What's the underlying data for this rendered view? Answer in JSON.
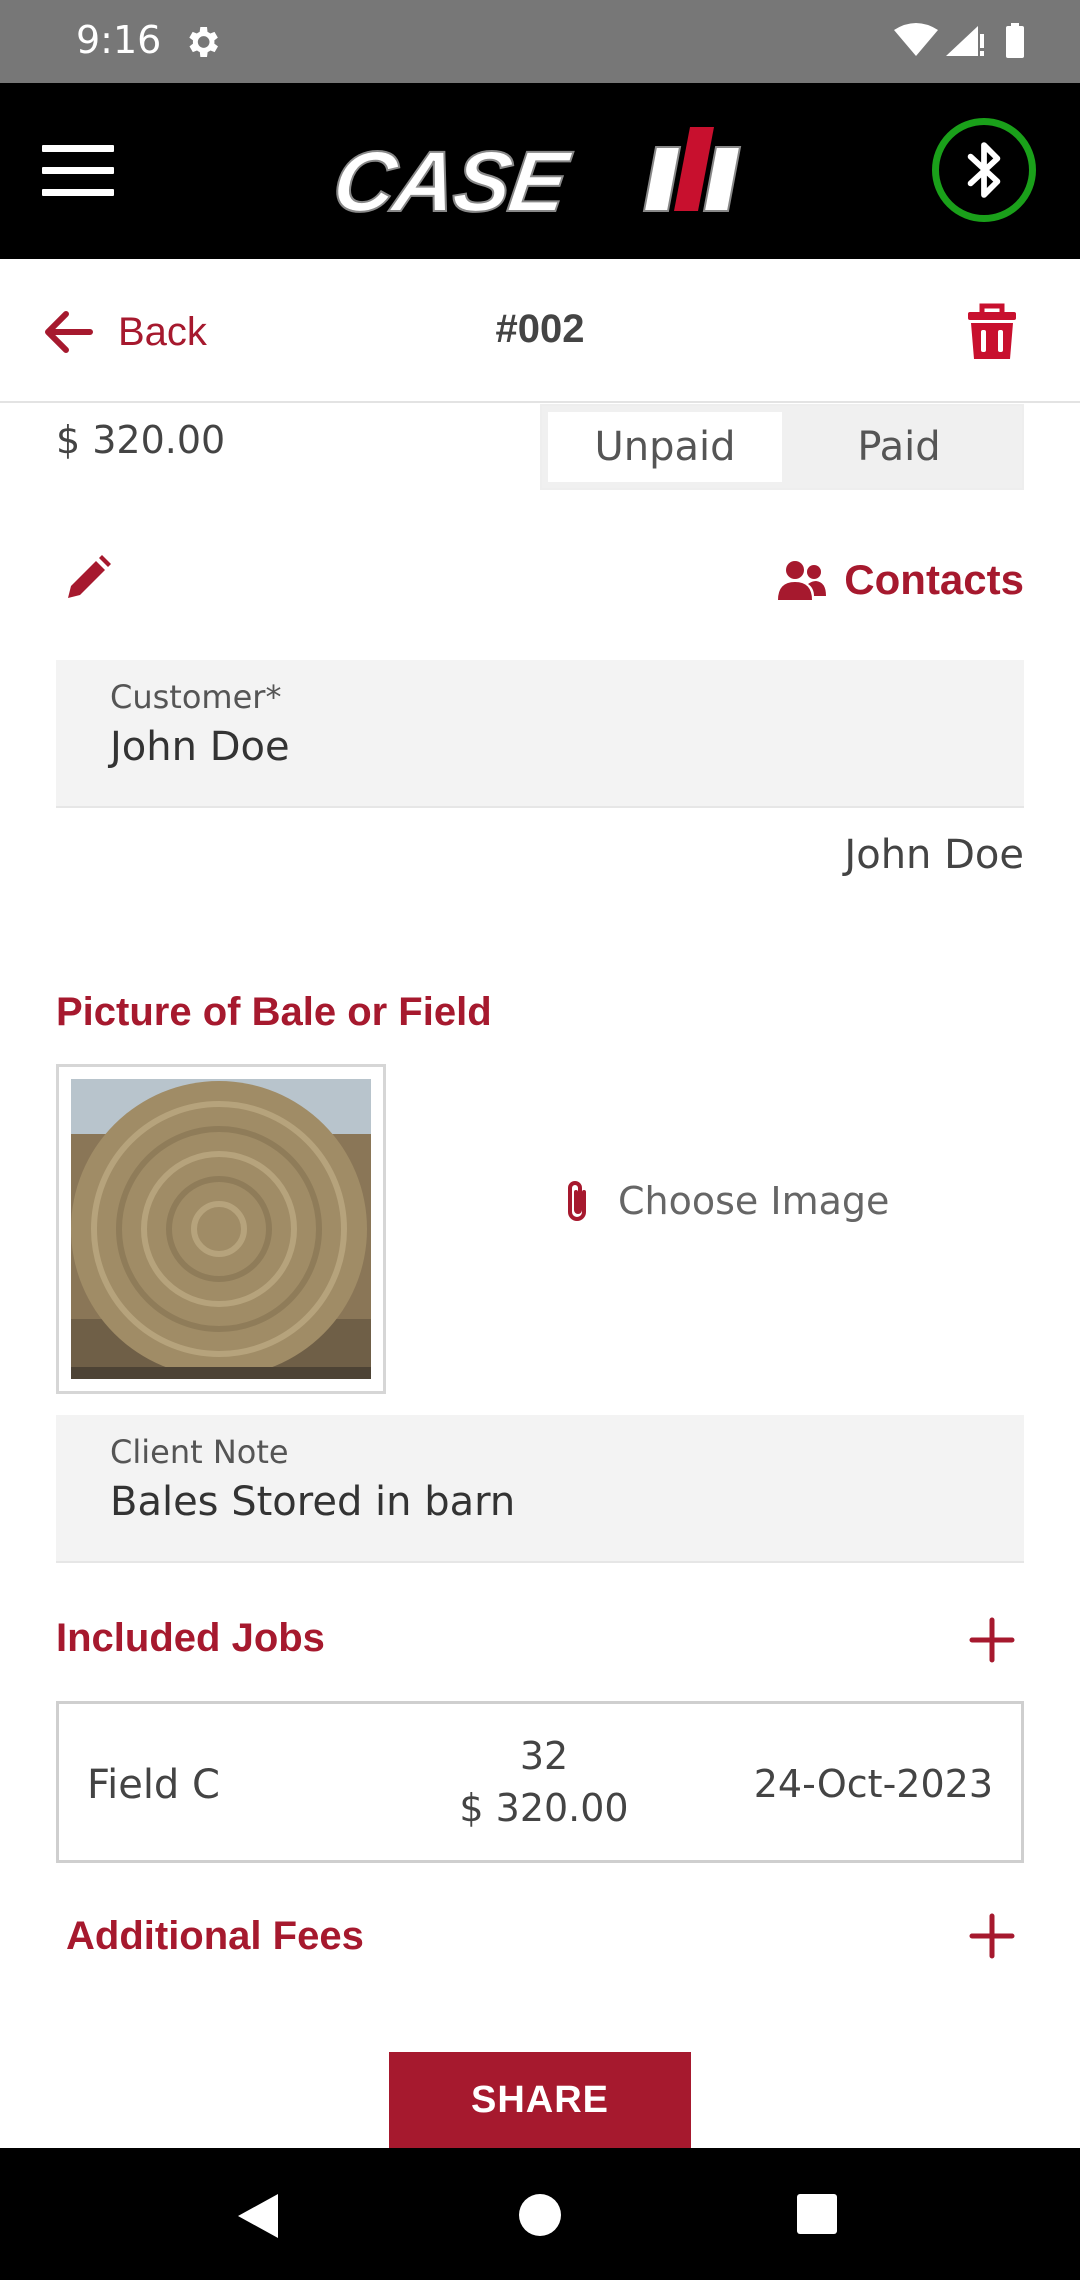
{
  "status_bar": {
    "time": "9:16"
  },
  "header": {
    "logo_text": "CASE"
  },
  "nav": {
    "back_label": "Back",
    "title": "#002"
  },
  "payment": {
    "amount": "$ 320.00",
    "unpaid_label": "Unpaid",
    "paid_label": "Paid",
    "selected": "Unpaid"
  },
  "actions": {
    "contacts_label": "Contacts"
  },
  "customer": {
    "label": "Customer*",
    "value": "John Doe",
    "display_name": "John Doe"
  },
  "picture_section": {
    "heading": "Picture of Bale or Field",
    "choose_label": "Choose Image"
  },
  "client_note": {
    "label": "Client Note",
    "value": "Bales Stored in barn"
  },
  "included_jobs": {
    "heading": "Included Jobs",
    "jobs": [
      {
        "name": "Field C",
        "quantity": "32",
        "price": "$ 320.00",
        "date": "24-Oct-2023"
      }
    ]
  },
  "additional_fees": {
    "heading": "Additional Fees"
  },
  "share_label": "SHARE",
  "colors": {
    "brand": "#a6192e",
    "bluetooth_ring": "#1aa01a",
    "header_bg": "#000000"
  }
}
